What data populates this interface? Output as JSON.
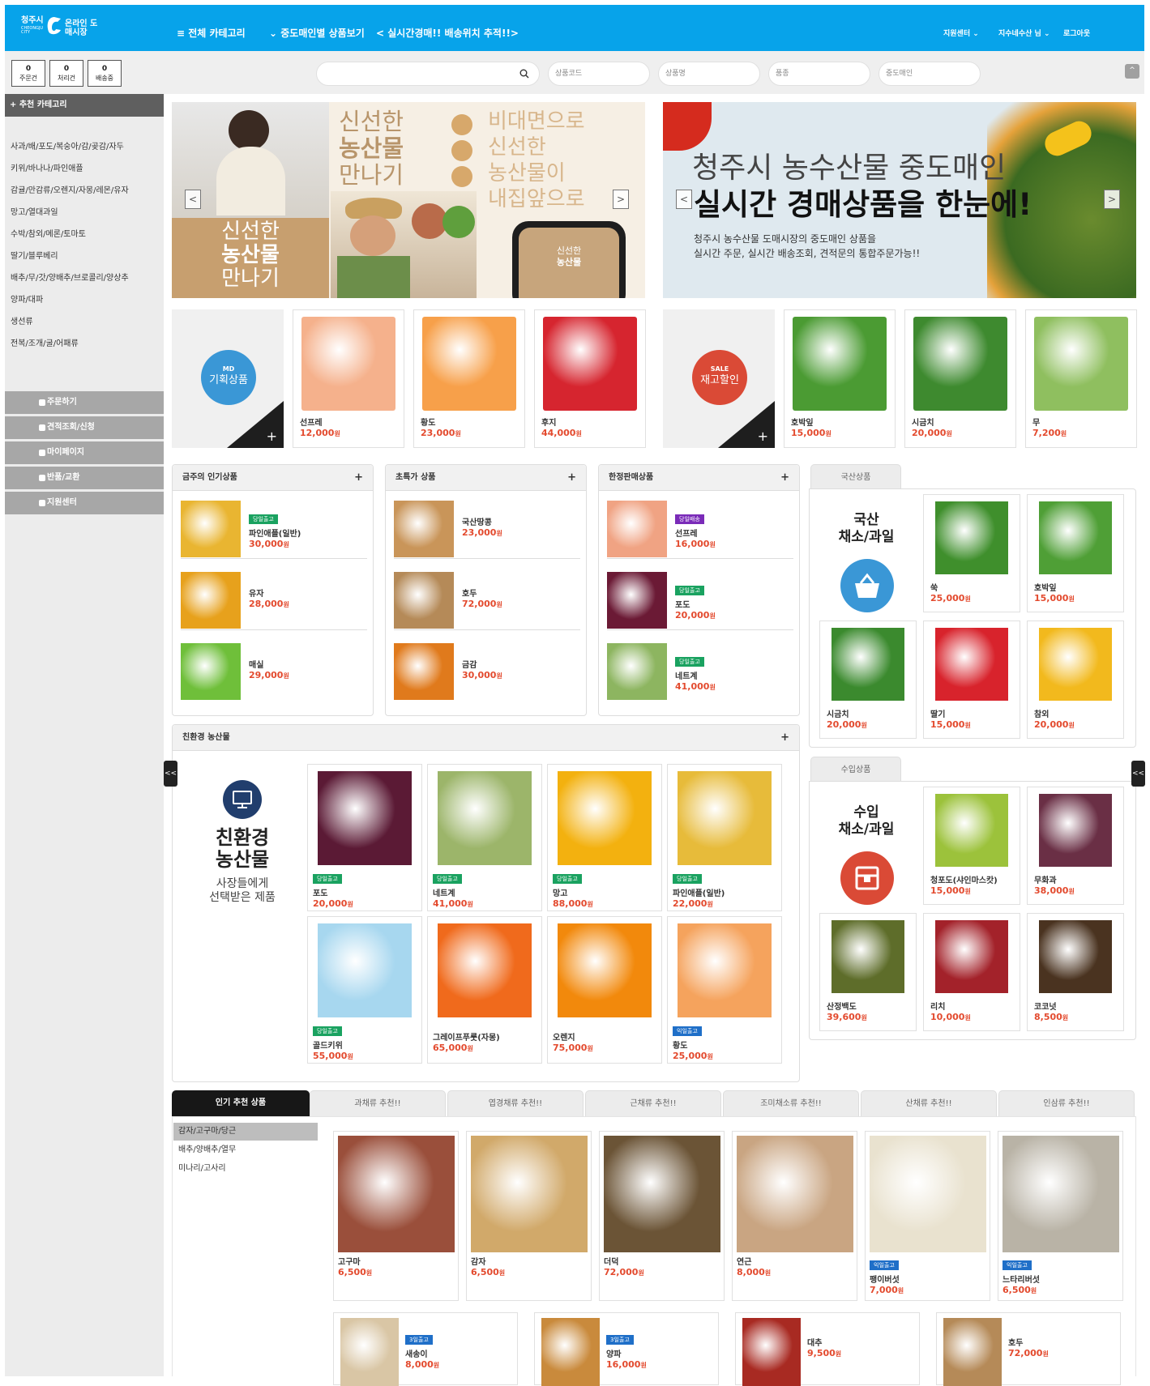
{
  "header": {
    "logo_city": "청주시",
    "logo_city_en": "CHEONGJU CITY",
    "logo_market": "온라인 도매시장",
    "nav_all": "≡ 전체 카테고리",
    "nav_wholesaler": "⌄ 중도매인별 상품보기",
    "nav_auction": "< 실시간경매!! 배송위치 추적!!>",
    "support": "지원센터 ⌄",
    "user": "지수네수산 님 ⌄",
    "logout": "로그아웃"
  },
  "subbar": {
    "counters": [
      {
        "value": "0",
        "label": "주문건"
      },
      {
        "value": "0",
        "label": "처리건"
      },
      {
        "value": "0",
        "label": "배송중"
      }
    ],
    "search_placeholder": "",
    "product_code_placeholder": "상품코드",
    "product_name_placeholder": "상품명",
    "variety_placeholder": "품종",
    "wholesaler_placeholder": "중도매인",
    "scroll_up": "^"
  },
  "sidebar": {
    "heading": "+ 추천 카테고리",
    "categories": [
      "사과/배/포도/복숭아/감/곶감/자두",
      "키위/바나나/파인애플",
      "감귤/만감류/오렌지/자몽/레몬/유자",
      "망고/열대과일",
      "수박/참외/메론/토마토",
      "딸기/블루베리",
      "배추/무/갓/양배추/브로콜리/양상추",
      "양파/대파",
      "생선류",
      "전복/조개/굴/어패류"
    ],
    "menu": [
      "주문하기",
      "견적조회/신청",
      "마이페이지",
      "반품/교환",
      "지원센터"
    ]
  },
  "banner1": {
    "title1": "신선한",
    "title2": "농산물",
    "title3": "만나기",
    "right1": "비대면으로",
    "right2": "신선한",
    "right3": "농산물이",
    "right4": "내집앞으로",
    "phone1": "신선한",
    "phone2": "농산물",
    "prev": "<",
    "next": ">"
  },
  "banner2": {
    "title": "청주시 농수산물 중도매인",
    "headline": "실시간 경매상품을 한눈에!",
    "desc1": "청주시 농수산물 도매시장의 중도매인 상품을",
    "desc2": "실시간 주문, 실시간 배송조회, 견적문의 통합주문가능!!",
    "prev": "<",
    "next": ">"
  },
  "md": {
    "tag": "MD",
    "label": "기획상품",
    "plus": "+",
    "items": [
      {
        "name": "선프레",
        "price": "12,000",
        "won": "원",
        "color": "#f5b18c"
      },
      {
        "name": "황도",
        "price": "23,000",
        "won": "원",
        "color": "#f7a04a"
      },
      {
        "name": "후지",
        "price": "44,000",
        "won": "원",
        "color": "#d6252f"
      }
    ]
  },
  "sale": {
    "tag": "SALE",
    "label": "재고할인",
    "plus": "+",
    "items": [
      {
        "name": "호박잎",
        "price": "15,000",
        "won": "원",
        "color": "#4b9b33"
      },
      {
        "name": "시금치",
        "price": "20,000",
        "won": "원",
        "color": "#3e8a2f"
      },
      {
        "name": "무",
        "price": "7,200",
        "won": "원",
        "color": "#8fbf5f"
      }
    ]
  },
  "weekly": {
    "title": "금주의 인기상품",
    "plus": "+",
    "items": [
      {
        "badge": "당일출고",
        "name": "파인애플(일반)",
        "price": "30,000",
        "won": "원",
        "color": "#e9b531"
      },
      {
        "badge": "",
        "name": "유자",
        "price": "28,000",
        "won": "원",
        "color": "#e7a11c"
      },
      {
        "badge": "",
        "name": "매실",
        "price": "29,000",
        "won": "원",
        "color": "#6fbf3a"
      }
    ]
  },
  "special": {
    "title": "초특가 상품",
    "plus": "+",
    "items": [
      {
        "name": "국산땅콩",
        "price": "23,000",
        "won": "원",
        "color": "#c99559"
      },
      {
        "name": "호두",
        "price": "72,000",
        "won": "원",
        "color": "#b58a58"
      },
      {
        "name": "금감",
        "price": "30,000",
        "won": "원",
        "color": "#e07a1c"
      }
    ]
  },
  "limited": {
    "title": "한정판매상품",
    "plus": "+",
    "items": [
      {
        "badge": "당일배송",
        "name": "선프레",
        "price": "16,000",
        "won": "원",
        "color": "#f0a383"
      },
      {
        "badge": "당일출고",
        "name": "포도",
        "price": "20,000",
        "won": "원",
        "color": "#6b1a35"
      },
      {
        "badge": "당일출고",
        "name": "네트계",
        "price": "41,000",
        "won": "원",
        "color": "#8db560"
      }
    ]
  },
  "domestic": {
    "tab": "국산상품",
    "title1": "국산",
    "title2": "채소/과일",
    "items": [
      {
        "name": "쑥",
        "price": "25,000",
        "won": "원",
        "color": "#3f8f2c"
      },
      {
        "name": "호박잎",
        "price": "15,000",
        "won": "원",
        "color": "#4f9f36"
      },
      {
        "name": "시금치",
        "price": "20,000",
        "won": "원",
        "color": "#3b8a2e"
      },
      {
        "name": "딸기",
        "price": "15,000",
        "won": "원",
        "color": "#d8232c"
      },
      {
        "name": "참외",
        "price": "20,000",
        "won": "원",
        "color": "#f2b91d"
      }
    ]
  },
  "imported": {
    "tab": "수입상품",
    "title1": "수입",
    "title2": "채소/과일",
    "items": [
      {
        "name": "청포도(샤인마스캇)",
        "price": "15,000",
        "won": "원",
        "color": "#9cc23b"
      },
      {
        "name": "무화과",
        "price": "38,000",
        "won": "원",
        "color": "#6a2f45"
      },
      {
        "name": "산정백도",
        "price": "39,600",
        "won": "원",
        "color": "#5e6d2a"
      },
      {
        "name": "리치",
        "price": "10,000",
        "won": "원",
        "color": "#a3222a"
      },
      {
        "name": "코코넛",
        "price": "8,500",
        "won": "원",
        "color": "#4a3320"
      }
    ]
  },
  "eco": {
    "title": "친환경 농산물",
    "plus": "+",
    "big1": "친환경",
    "big2": "농산물",
    "sub1": "사장들에게",
    "sub2": "선택받은 제품",
    "items": [
      {
        "badge": "당일출고",
        "name": "포도",
        "price": "20,000",
        "won": "원",
        "color": "#5b1a35"
      },
      {
        "badge": "당일출고",
        "name": "네트계",
        "price": "41,000",
        "won": "원",
        "color": "#9cb56a"
      },
      {
        "badge": "당일출고",
        "name": "망고",
        "price": "88,000",
        "won": "원",
        "color": "#f3b10f"
      },
      {
        "badge": "당일출고",
        "name": "파인애플(일반)",
        "price": "22,000",
        "won": "원",
        "color": "#e7bb3a"
      },
      {
        "badge": "당일출고",
        "name": "골드키위",
        "price": "55,000",
        "won": "원",
        "color": "#a7d7ef"
      },
      {
        "badge": "",
        "name": "그레이프푸룻(자몽)",
        "price": "65,000",
        "won": "원",
        "color": "#f06a1c"
      },
      {
        "badge": "",
        "name": "오렌지",
        "price": "75,000",
        "won": "원",
        "color": "#f2890c"
      },
      {
        "badge": "익일출고",
        "name": "황도",
        "price": "25,000",
        "won": "원",
        "color": "#f5a35d"
      }
    ]
  },
  "reco": {
    "tabs": [
      "인기 추천 상품",
      "과채류 추천!!",
      "엽경채류 추천!!",
      "근채류 추천!!",
      "조미채소류 추천!!",
      "산채류 추천!!",
      "인삼류 추천!!"
    ],
    "subcats": [
      "감자/고구마/당근",
      "배추/양배추/열무",
      "미나리/고사리"
    ],
    "items": [
      {
        "badge": "",
        "name": "고구마",
        "price": "6,500",
        "won": "원",
        "color": "#9a4f3b"
      },
      {
        "badge": "",
        "name": "감자",
        "price": "6,500",
        "won": "원",
        "color": "#d1a96a"
      },
      {
        "badge": "",
        "name": "더덕",
        "price": "72,000",
        "won": "원",
        "color": "#6b5436"
      },
      {
        "badge": "",
        "name": "연근",
        "price": "8,000",
        "won": "원",
        "color": "#c9a582"
      },
      {
        "badge": "익일출고",
        "name": "팽이버섯",
        "price": "7,000",
        "won": "원",
        "color": "#e9e2cf"
      },
      {
        "badge": "익일출고",
        "name": "느타리버섯",
        "price": "6,500",
        "won": "원",
        "color": "#b9b3a6"
      }
    ],
    "small": [
      {
        "badge": "3일출고",
        "name": "새송이",
        "price": "8,000",
        "won": "원",
        "color": "#d9c6a5"
      },
      {
        "badge": "3일출고",
        "name": "양파",
        "price": "16,000",
        "won": "원",
        "color": "#c98a3c"
      },
      {
        "badge": "",
        "name": "대추",
        "price": "9,500",
        "won": "원",
        "color": "#a82a22"
      },
      {
        "badge": "",
        "name": "호두",
        "price": "72,000",
        "won": "원",
        "color": "#b58a58"
      }
    ]
  },
  "collapse_left": "<<",
  "collapse_right": "<<"
}
